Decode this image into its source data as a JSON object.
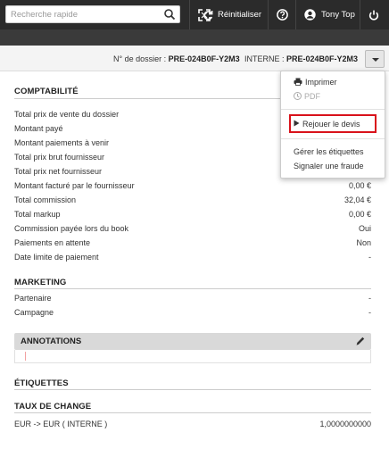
{
  "topbar": {
    "search_placeholder": "Recherche rapide",
    "reset_label": "Réinitialiser",
    "user_name": "Tony Top"
  },
  "dossier": {
    "number_label": "N° de dossier :",
    "number_value": "PRE-024B0F-Y2M3",
    "internal_label": "INTERNE :",
    "internal_value": "PRE-024B0F-Y2M3"
  },
  "menu": {
    "print": "Imprimer",
    "pdf": "PDF",
    "replay": "Rejouer le devis",
    "manage_tags": "Gérer les étiquettes",
    "report_fraud": "Signaler une fraude"
  },
  "accounting": {
    "title": "COMPTABILITÉ",
    "rows": [
      {
        "label": "Total prix de vente du dossier",
        "value": ""
      },
      {
        "label": "Montant payé",
        "value": ""
      },
      {
        "label": "Montant paiements à venir",
        "value": ""
      },
      {
        "label": "Total prix brut fournisseur",
        "value": ""
      },
      {
        "label": "Total prix net fournisseur",
        "value": ""
      },
      {
        "label": "Montant facturé par le fournisseur",
        "value": "0,00 €"
      },
      {
        "label": "Total commission",
        "value": "32,04 €"
      },
      {
        "label": "Total markup",
        "value": "0,00 €"
      },
      {
        "label": "Commission payée lors du book",
        "value": "Oui"
      },
      {
        "label": "Paiements en attente",
        "value": "Non"
      },
      {
        "label": "Date limite de paiement",
        "value": "-"
      }
    ]
  },
  "marketing": {
    "title": "MARKETING",
    "rows": [
      {
        "label": "Partenaire",
        "value": "-"
      },
      {
        "label": "Campagne",
        "value": "-"
      }
    ]
  },
  "annotations": {
    "title": "ANNOTATIONS"
  },
  "tags": {
    "title": "ÉTIQUETTES"
  },
  "exchange": {
    "title": "TAUX DE CHANGE",
    "rows": [
      {
        "label": "EUR -> EUR ( INTERNE )",
        "value": "1,0000000000"
      }
    ]
  },
  "colors": {
    "topbar_bg": "#2b2b2b",
    "highlight_border": "#d9121b",
    "annotations_bg": "#d9d9d9"
  },
  "icons": [
    "search-icon",
    "expand-icon",
    "refresh-icon",
    "help-icon",
    "user-icon",
    "power-icon",
    "chevron-down-icon",
    "print-icon",
    "pdf-icon",
    "play-icon",
    "pencil-icon"
  ]
}
